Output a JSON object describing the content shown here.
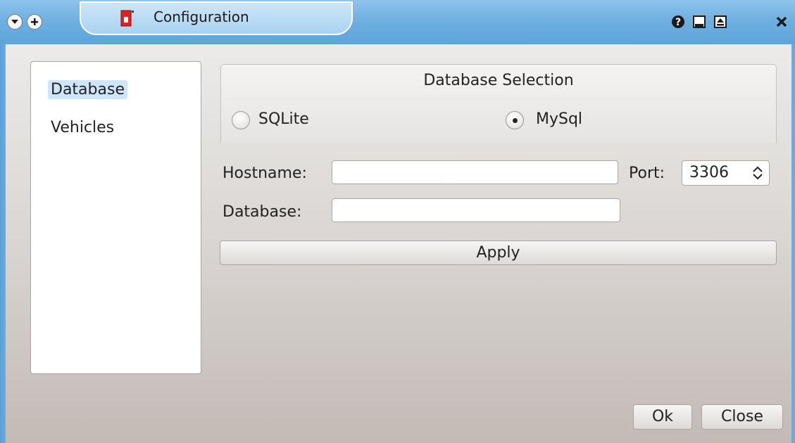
{
  "window": {
    "title": "Configuration",
    "titlebar_icons": [
      "menu-down-icon",
      "plus-icon",
      "app-icon",
      "help-icon",
      "minimize-icon",
      "maximize-icon",
      "close-icon"
    ],
    "accent_color": "#6fb0e1"
  },
  "sidebar": {
    "items": [
      {
        "label": "Database",
        "selected": true
      },
      {
        "label": "Vehicles",
        "selected": false
      }
    ]
  },
  "database_selection": {
    "title": "Database Selection",
    "options": [
      {
        "label": "SQLite",
        "checked": false
      },
      {
        "label": "MySql",
        "checked": true
      }
    ]
  },
  "form": {
    "hostname_label": "Hostname:",
    "hostname_value": "",
    "port_label": "Port:",
    "port_value": "3306",
    "database_label": "Database:",
    "database_value": ""
  },
  "buttons": {
    "apply": "Apply",
    "ok": "Ok",
    "close": "Close"
  }
}
